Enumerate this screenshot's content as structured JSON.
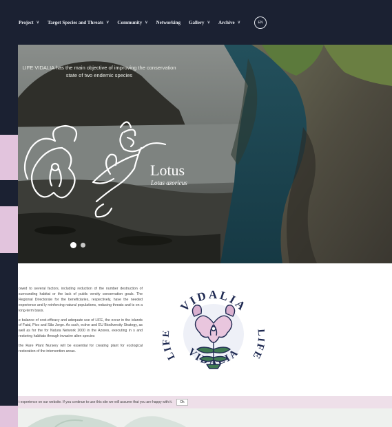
{
  "nav": {
    "items": [
      {
        "label": "Project",
        "dropdown": true
      },
      {
        "label": "Target Species and Threats",
        "dropdown": true
      },
      {
        "label": "Community",
        "dropdown": true
      },
      {
        "label": "Networking",
        "dropdown": false
      },
      {
        "label": "Gallery",
        "dropdown": true
      },
      {
        "label": "Archive",
        "dropdown": true
      }
    ],
    "chevron": "∨",
    "language": "EN"
  },
  "hero": {
    "intro": "LIFE VIDALIA has the main objective of improving the conservation state of two endemic species",
    "title": "Lotus",
    "subtitle": "Lotus azoricus",
    "slide_count": 2,
    "active_slide": 1
  },
  "content": {
    "paragraphs": [
      "owed to several factors, including reduction of the number destruction of surrounding habitat or the lack of public versity conservation goals. The Regional Directorate for the beneficiaries, respectively, have the needed experience and ly reinforcing natural populations, reducing threats and ts on a long-term basis.",
      "e balance of cost-efficacy and adequate use of LIFE, the occur in the islands of Faial, Pico and São Jorge. As such, ective and EU Biodiversity Strategy, as well as for the for Natura Network 2000 in the Azores, executing in s and restoring habitats through invasive alien species",
      "the Rare Plant Nursery will be essential for creating plant for ecological restoration of the intervention areas."
    ]
  },
  "logo": {
    "text_top": "VIDALIA",
    "text_bottom": "VIDALIA",
    "text_left": "LIFE",
    "text_right": "LIFE"
  },
  "cookie": {
    "message": "t experience on our website. If you continue to use this site we will assume that you are happy with it.",
    "ok_label": "Ok"
  },
  "colors": {
    "nav_bg": "#1b2132",
    "accent_pink": "#e2c4dd",
    "cookie_bg": "#eedfe9",
    "logo_green": "#3f7a52",
    "logo_navy": "#1f2a52"
  }
}
